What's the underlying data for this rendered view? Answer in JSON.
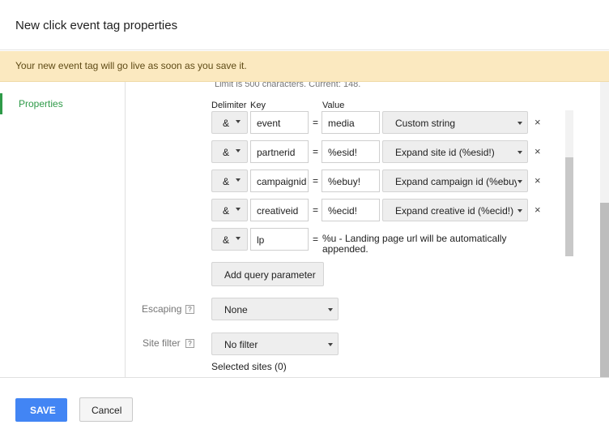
{
  "dialog": {
    "title": "New click event tag properties"
  },
  "notice": {
    "text": "Your new event tag will go live as soon as you save it."
  },
  "nav": {
    "items": [
      {
        "label": "Properties"
      }
    ]
  },
  "params": {
    "limit_text": "Limit is 500 characters. Current: 148.",
    "headers": {
      "delimiter": "Delimiter",
      "key": "Key",
      "value": "Value"
    },
    "equals": "=",
    "remove_symbol": "×",
    "rows": [
      {
        "delimiter": "&",
        "key": "event",
        "value": "media",
        "type": "Custom string"
      },
      {
        "delimiter": "&",
        "key": "partnerid",
        "value": "%esid!",
        "type": "Expand site id (%esid!)"
      },
      {
        "delimiter": "&",
        "key": "campaignid",
        "value": "%ebuy!",
        "type": "Expand campaign id (%ebuy!)"
      },
      {
        "delimiter": "&",
        "key": "creativeid",
        "value": "%ecid!",
        "type": "Expand creative id (%ecid!)"
      }
    ],
    "lp_row": {
      "delimiter": "&",
      "key": "lp",
      "note": "%u - Landing page url will be automatically appended."
    },
    "add_button": "Add query parameter"
  },
  "escaping": {
    "label": "Escaping",
    "help": "?",
    "value": "None"
  },
  "site_filter": {
    "label": "Site filter",
    "help": "?",
    "value": "No filter",
    "selected_sites": "Selected sites (0)"
  },
  "footer": {
    "save": "SAVE",
    "cancel": "Cancel"
  },
  "colors": {
    "accent_green": "#2e9a48",
    "save_blue": "#4285f4",
    "notice_bg": "#fbe9c0"
  }
}
